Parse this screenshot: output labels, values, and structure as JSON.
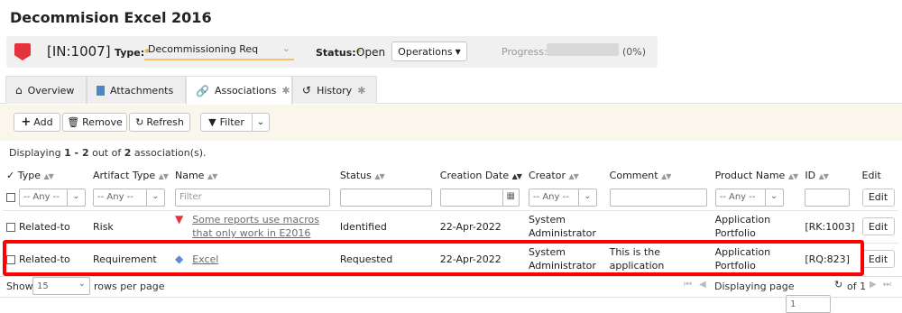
{
  "page": {
    "title": "Decommision Excel 2016"
  },
  "header": {
    "artifact_id": "[IN:1007]",
    "type_label": "Type:",
    "type_value": "Decommissioning Req",
    "status_label": "Status:",
    "status_value": "Open",
    "operations_label": "Operations",
    "progress_label": "Progress:",
    "progress_value": "(0%)",
    "progress_fraction": 0
  },
  "tabs": [
    {
      "label": "Overview",
      "icon": "home-icon"
    },
    {
      "label": "Attachments",
      "icon": "document-icon"
    },
    {
      "label": "Associations",
      "icon": "link-icon",
      "active": true
    },
    {
      "label": "History",
      "icon": "history-icon"
    }
  ],
  "toolbar": {
    "add_label": "Add",
    "remove_label": "Remove",
    "refresh_label": "Refresh",
    "filter_label": "Filter"
  },
  "display_summary": {
    "prefix": "Displaying ",
    "from": "1",
    "dash": " - ",
    "to": "2",
    "mid": " out of ",
    "total": "2",
    "suffix": " association(s)."
  },
  "table": {
    "columns": [
      "Type",
      "Artifact Type",
      "Name",
      "Status",
      "Creation Date",
      "Creator",
      "Comment",
      "Product Name",
      "ID",
      "Edit"
    ],
    "filters": {
      "any": "-- Any --",
      "name_placeholder": "Filter",
      "edit_label": "Edit"
    },
    "rows": [
      {
        "type": "Related-to",
        "artifact_type": "Risk",
        "name": "Some reports use macros that only work in E2016",
        "status": "Identified",
        "created": "22-Apr-2022",
        "creator": "System Administrator",
        "comment": "",
        "product": "Application Portfolio",
        "id": "[RK:1003]",
        "edit": "Edit",
        "icon": "risk-icon"
      },
      {
        "type": "Related-to",
        "artifact_type": "Requirement",
        "name": "Excel",
        "status": "Requested",
        "created": "22-Apr-2022",
        "creator": "System Administrator",
        "comment": "This is the application",
        "product": "Application Portfolio",
        "id": "[RQ:823]",
        "edit": "Edit",
        "icon": "requirement-icon"
      }
    ]
  },
  "footer": {
    "show_label": "Show",
    "page_size": "15",
    "rows_per_page_label": "rows per page",
    "displaying_page_label": "Displaying page",
    "page_number": "1",
    "of_label": "of 1"
  },
  "colors": {
    "accent_red": "#e5333d",
    "highlight": "#ff0000",
    "required_star": "#e5a000",
    "toolbar_bg": "#fbf6ec"
  }
}
